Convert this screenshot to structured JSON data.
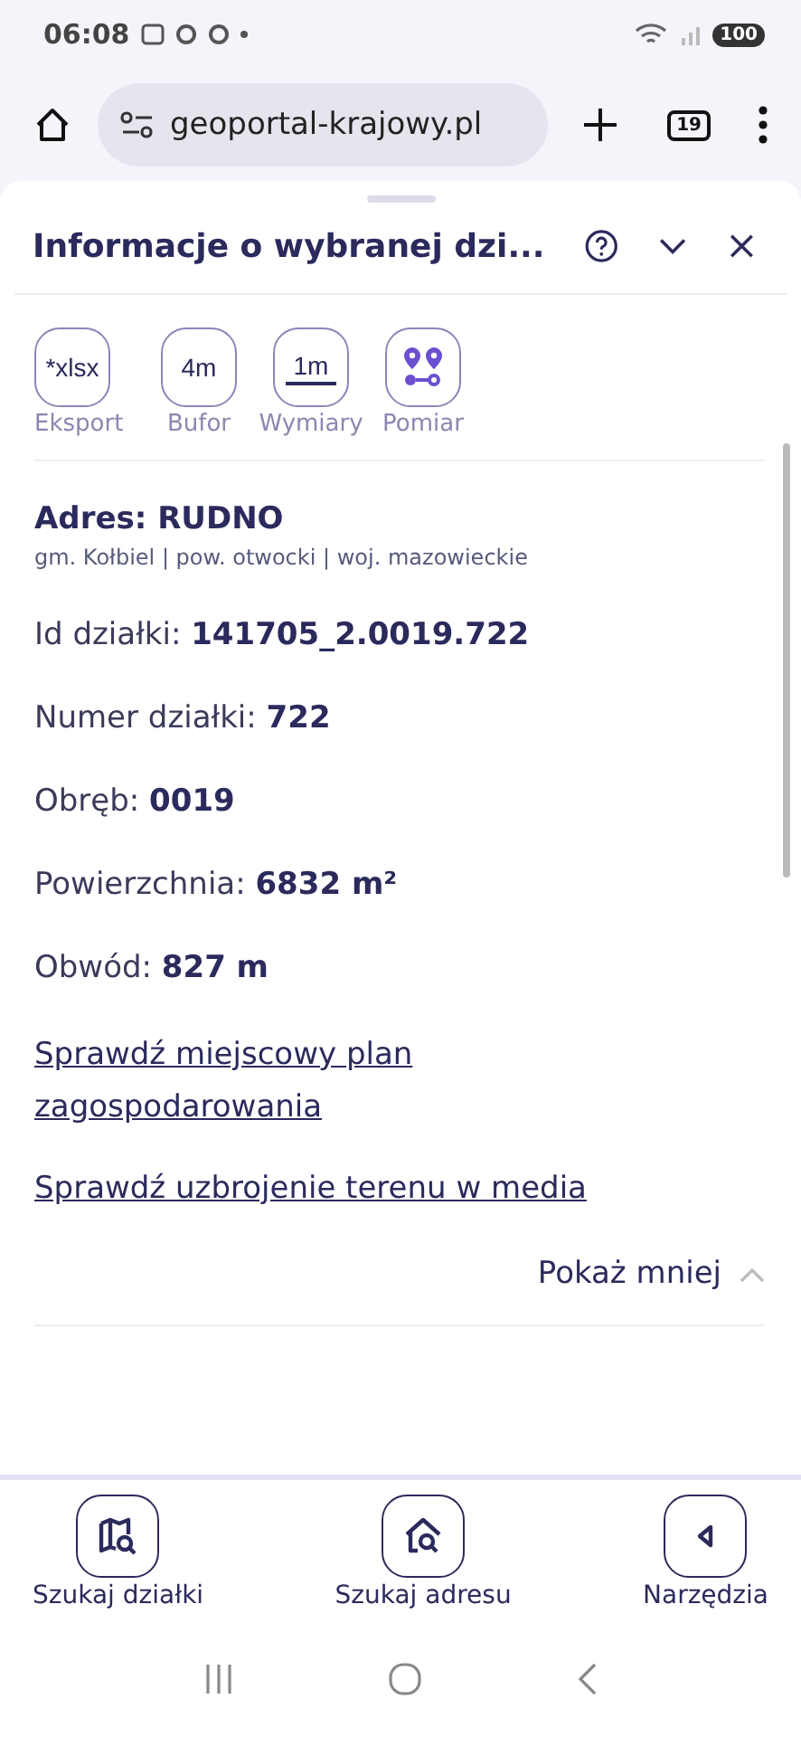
{
  "status_bar": {
    "time": "06:08",
    "battery": "100"
  },
  "browser": {
    "url": "geoportal-krajowy.pl",
    "tab_count": "19"
  },
  "panel": {
    "title": "Informacje o wybranej dzi...",
    "tools": [
      {
        "kind": "text",
        "icon_text": "*xlsx",
        "label": "Eksport"
      },
      {
        "kind": "text",
        "icon_text": "4m",
        "label": "Bufor"
      },
      {
        "kind": "measure",
        "icon_text": "1m",
        "label": "Wymiary"
      },
      {
        "kind": "pins",
        "label": "Pomiar"
      }
    ],
    "address": {
      "title": "Adres: RUDNO",
      "subtitle": "gm. Kołbiel | pow. otwocki | woj. mazowieckie"
    },
    "fields": [
      {
        "label": "Id działki:",
        "value": "141705_2.0019.722"
      },
      {
        "label": "Numer działki:",
        "value": "722"
      },
      {
        "label": "Obręb:",
        "value": "0019"
      },
      {
        "label": "Powierzchnia:",
        "value": "6832 m²"
      },
      {
        "label": "Obwód:",
        "value": "827 m"
      }
    ],
    "links": [
      "Sprawdź miejscowy plan zagospodarowania",
      "Sprawdź uzbrojenie terenu w media"
    ],
    "toggle": "Pokaż mniej"
  },
  "bottom_nav": [
    {
      "kind": "map",
      "label": "Szukaj działki"
    },
    {
      "kind": "house",
      "label": "Szukaj adresu"
    },
    {
      "kind": "back",
      "label": "Narzędzia"
    }
  ]
}
